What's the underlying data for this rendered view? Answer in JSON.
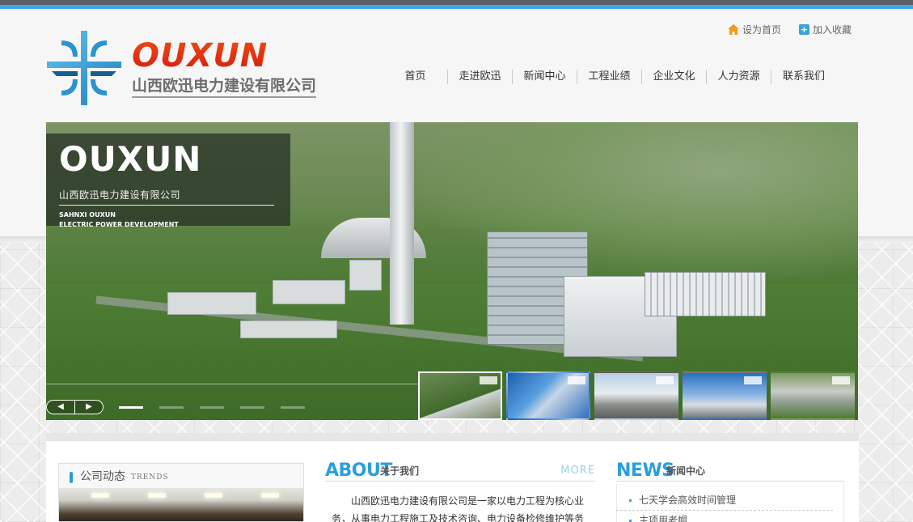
{
  "header": {
    "logo_en": "OUXUN",
    "logo_cn": "山西欧迅电力建设有限公司",
    "top_links": [
      {
        "label": "设为首页",
        "icon": "home-icon"
      },
      {
        "label": "加入收藏",
        "icon": "plus-icon"
      }
    ]
  },
  "nav": {
    "items": [
      "首页",
      "走进欧迅",
      "新闻中心",
      "工程业绩",
      "企业文化",
      "人力资源",
      "联系我们"
    ]
  },
  "banner": {
    "overlay_en": "OUXUN",
    "overlay_cn": "山西欧迅电力建设有限公司",
    "overlay_sub1": "SAHNXI OUXUN",
    "overlay_sub2": "ELECTRIC POWER DEVELOPMENT",
    "prev_label": "◀",
    "next_label": "▶",
    "slide_count": 5,
    "active_slide": 1
  },
  "trends": {
    "title": "公司动态",
    "title_en": "TRENDS"
  },
  "about": {
    "title": "ABOUT",
    "subtitle": "关于我们",
    "more": "MORE",
    "text": "山西欧迅电力建设有限公司是一家以电力工程为核心业务，从事电力工程施工及技术咨询、电力设备检修维护等务"
  },
  "news": {
    "title": "NEWS",
    "subtitle": "新闻中心",
    "items": [
      "七天学会高效时间管理",
      "主项用老帽"
    ]
  },
  "colors": {
    "accent": "#3fa9df",
    "brand_red": "#e2341a",
    "logo_grey": "#6d6d6d"
  }
}
